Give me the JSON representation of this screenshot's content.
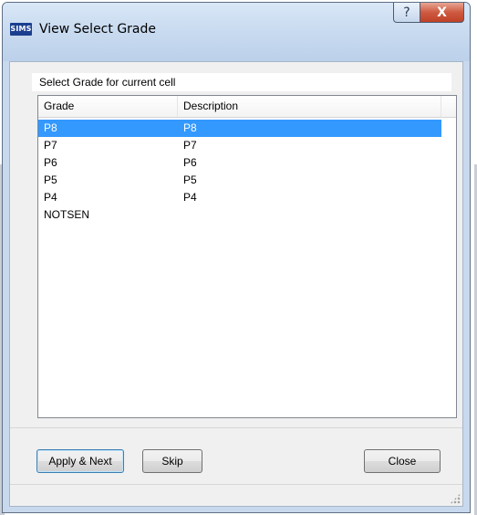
{
  "window": {
    "title": "View Select Grade",
    "app_icon_text": "SIMS",
    "help_glyph": "?",
    "close_glyph": "X"
  },
  "prompt": "Select Grade for current cell",
  "table": {
    "columns": [
      "Grade",
      "Description"
    ],
    "rows": [
      {
        "grade": "P8",
        "description": "P8",
        "selected": true
      },
      {
        "grade": "P7",
        "description": "P7"
      },
      {
        "grade": "P6",
        "description": "P6"
      },
      {
        "grade": "P5",
        "description": "P5"
      },
      {
        "grade": "P4",
        "description": "P4"
      },
      {
        "grade": "NOTSEN",
        "description": ""
      }
    ]
  },
  "buttons": {
    "apply_next": "Apply & Next",
    "skip": "Skip",
    "close": "Close"
  },
  "colors": {
    "selection": "#3399ff",
    "close_button": "#c04126"
  }
}
